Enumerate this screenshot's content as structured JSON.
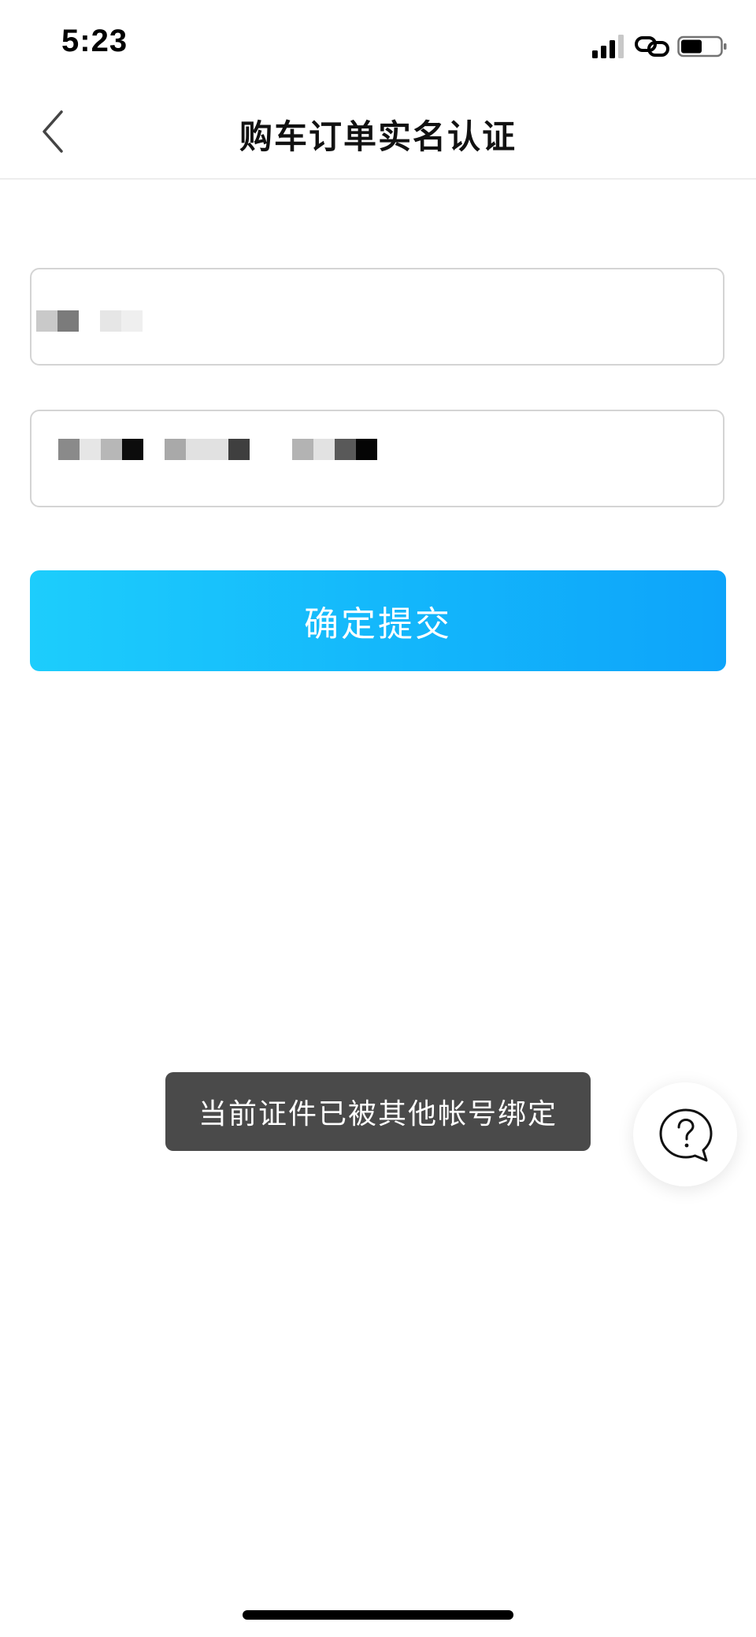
{
  "status_bar": {
    "time": "5:23",
    "icons": [
      "signal-icon",
      "link-icon",
      "battery-icon"
    ]
  },
  "nav": {
    "title": "购车订单实名认证",
    "back_icon": "chevron-left-icon"
  },
  "form": {
    "name_field": {
      "value_redacted": true
    },
    "id_field": {
      "value_redacted": true
    },
    "submit_label": "确定提交"
  },
  "toast": {
    "message": "当前证件已被其他帐号绑定"
  },
  "help_button": {
    "icon": "help-icon"
  },
  "colors": {
    "submit_gradient_start": "#1dcdfc",
    "submit_gradient_end": "#0ea4fa",
    "toast_bg": "#4a4a4a",
    "title_text": "#111111",
    "field_border": "#d4d4d4"
  }
}
